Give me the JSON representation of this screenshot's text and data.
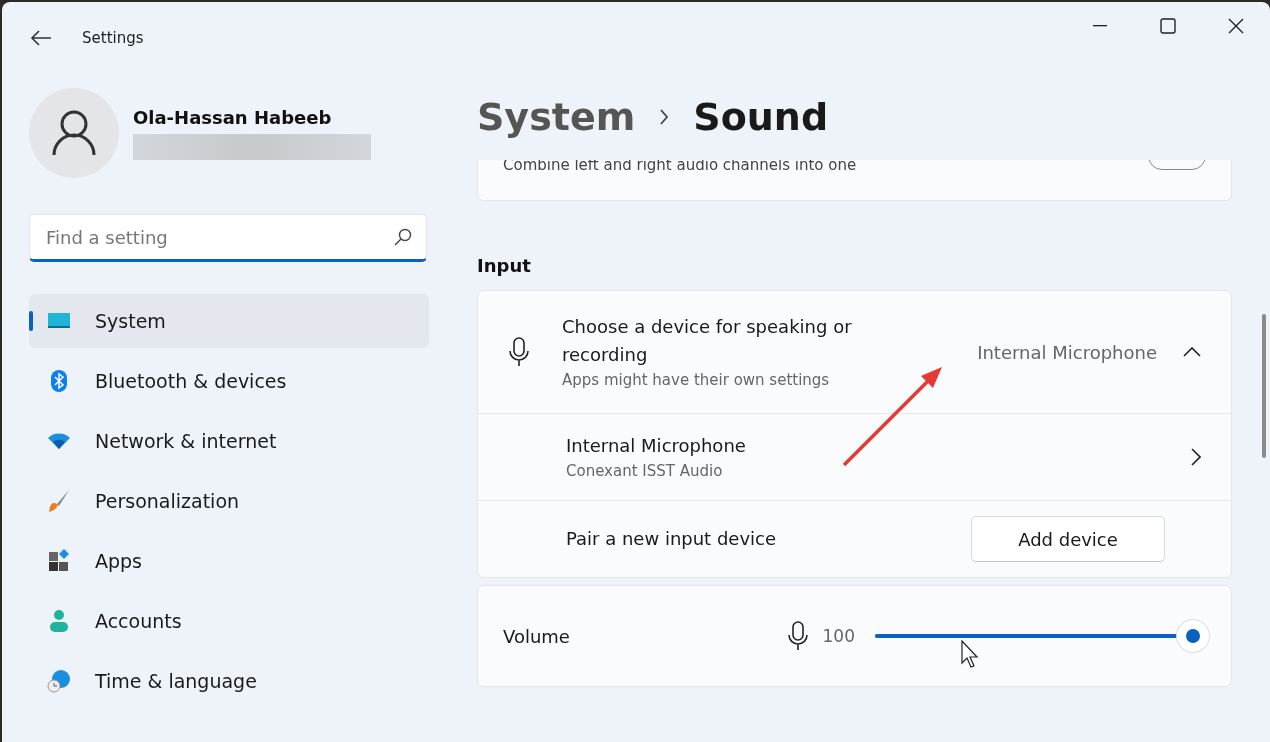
{
  "window": {
    "title": "Settings"
  },
  "profile": {
    "name": "Ola-Hassan Habeeb"
  },
  "search": {
    "placeholder": "Find a setting"
  },
  "sidebar": {
    "items": [
      {
        "label": "System",
        "selected": true
      },
      {
        "label": "Bluetooth & devices",
        "selected": false
      },
      {
        "label": "Network & internet",
        "selected": false
      },
      {
        "label": "Personalization",
        "selected": false
      },
      {
        "label": "Apps",
        "selected": false
      },
      {
        "label": "Accounts",
        "selected": false
      },
      {
        "label": "Time & language",
        "selected": false
      }
    ]
  },
  "breadcrumb": {
    "parent": "System",
    "current": "Sound"
  },
  "partial_card": {
    "description": "Combine left and right audio channels into one",
    "on": false
  },
  "input_section": {
    "heading": "Input",
    "device_chooser": {
      "title": "Choose a device for speaking or recording",
      "subtitle": "Apps might have their own settings",
      "value": "Internal Microphone",
      "expanded": true
    },
    "device": {
      "name": "Internal Microphone",
      "detail": "Conexant ISST Audio"
    },
    "pair": {
      "label": "Pair a new input device",
      "button": "Add device"
    },
    "volume": {
      "label": "Volume",
      "reading": "100",
      "level": 1
    }
  }
}
